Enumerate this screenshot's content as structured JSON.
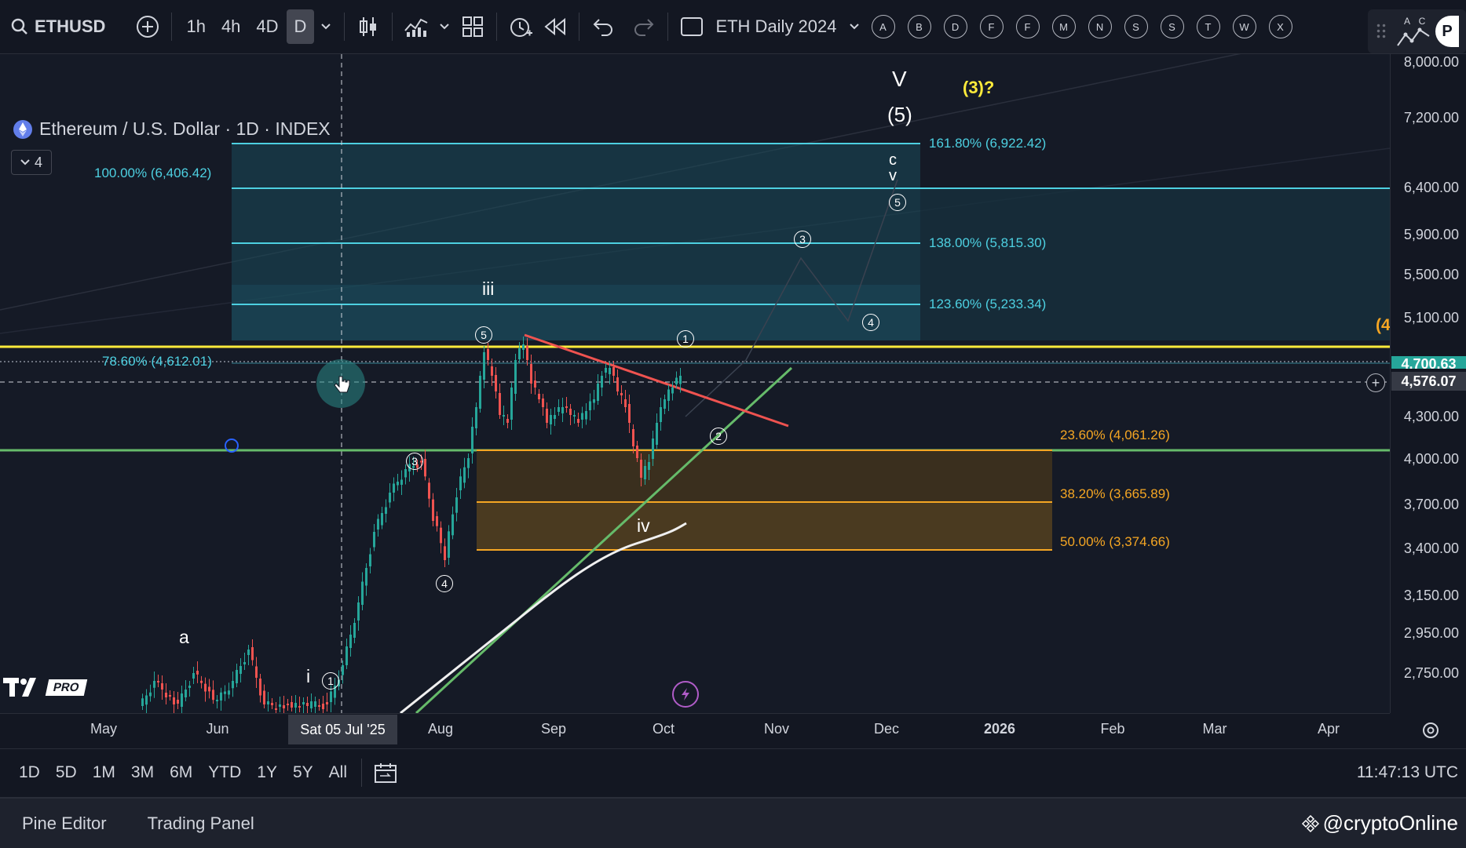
{
  "toolbar": {
    "symbol": "ETHUSD",
    "timeframes": [
      "1h",
      "4h",
      "4D",
      "D"
    ],
    "active_timeframe": "D",
    "layout_name": "ETH Daily 2024",
    "alpha_buttons": [
      "A",
      "B",
      "D",
      "F",
      "F",
      "M",
      "N",
      "S",
      "S",
      "T",
      "W",
      "X"
    ],
    "right_letters": "A C",
    "right_cut": "P"
  },
  "legend": {
    "title": "Ethereum / U.S. Dollar · 1D · INDEX",
    "indicator_count": "4"
  },
  "price_axis": {
    "labels": [
      "8,000.00",
      "7,200.00",
      "6,400.00",
      "5,900.00",
      "5,500.00",
      "5,100.00",
      "4,300.00",
      "4,000.00",
      "3,700.00",
      "3,400.00",
      "3,150.00",
      "2,950.00",
      "2,750.00"
    ],
    "tag_upper": "4,700.63",
    "tag_current": "4,576.07"
  },
  "time_axis": {
    "labels": [
      "May",
      "Jun",
      "Aug",
      "Sep",
      "Oct",
      "Nov",
      "Dec",
      "2026",
      "Feb",
      "Mar",
      "Apr"
    ],
    "crosshair_date": "Sat 05 Jul '25"
  },
  "fib_upper": {
    "levels": [
      {
        "label": "161.80% (6,922.42)"
      },
      {
        "label": "100.00% (6,406.42)"
      },
      {
        "label": "138.00% (5,815.30)"
      },
      {
        "label": "123.60% (5,233.34)"
      },
      {
        "label": "78.60% (4,612.01)"
      }
    ],
    "color": "#4dd0e1"
  },
  "fib_lower": {
    "levels": [
      {
        "label": "23.60% (4,061.26)"
      },
      {
        "label": "38.20% (3,665.89)"
      },
      {
        "label": "50.00% (3,374.66)"
      }
    ],
    "color": "#f5a623"
  },
  "waves": {
    "big_v": "V",
    "big_5": "(5)",
    "yellow_3": "(3)?",
    "c": "c",
    "v": "v",
    "iii": "iii",
    "iv": "iv",
    "i": "i",
    "a": "a",
    "yellow_cut": "(4"
  },
  "circled": [
    "5",
    "3",
    "4",
    "1",
    "2",
    "3",
    "4",
    "5",
    "1"
  ],
  "logo": "PRO",
  "bottom_bar": {
    "periods": [
      "1D",
      "5D",
      "1M",
      "3M",
      "6M",
      "YTD",
      "1Y",
      "5Y",
      "All"
    ],
    "clock": "11:47:13 UTC"
  },
  "panels": {
    "pine_editor": "Pine Editor",
    "trading_panel": "Trading Panel",
    "watermark": "@cryptoOnline"
  },
  "colors": {
    "bg": "#131722",
    "candle": "#26a69a",
    "candle_down": "#ef5350",
    "fib_cyan": "#4dd0e1",
    "fib_orange": "#f5a623",
    "yellow_line": "#ffeb3b",
    "green_line": "#66bb6a",
    "red_line": "#ef5350"
  }
}
